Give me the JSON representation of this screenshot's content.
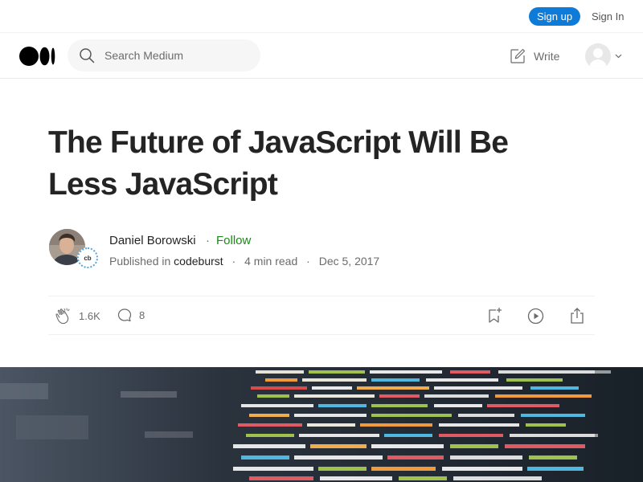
{
  "topbar": {
    "signup_label": "Sign up",
    "signin_label": "Sign In"
  },
  "nav": {
    "logo": "medium-logo",
    "search": {
      "placeholder": "Search Medium",
      "value": ""
    },
    "write_label": "Write"
  },
  "article": {
    "title": "The Future of JavaScript Will Be Less JavaScript",
    "author": "Daniel Borowski",
    "follow_label": "Follow",
    "published_prefix": "Published in",
    "publication": "codeburst",
    "publication_badge": "cb",
    "read_time": "4 min read",
    "date": "Dec 5, 2017",
    "claps": "1.6K",
    "responses": "8"
  },
  "colors": {
    "accent_green": "#1a8917",
    "signup_blue": "#0f7bd8",
    "text": "#242424",
    "muted": "#6b6b6b"
  },
  "icons": [
    "medium-logo",
    "search-icon",
    "write-icon",
    "avatar",
    "chevron-down-icon",
    "clap-icon",
    "comment-icon",
    "bookmark-add-icon",
    "play-icon",
    "share-icon"
  ]
}
